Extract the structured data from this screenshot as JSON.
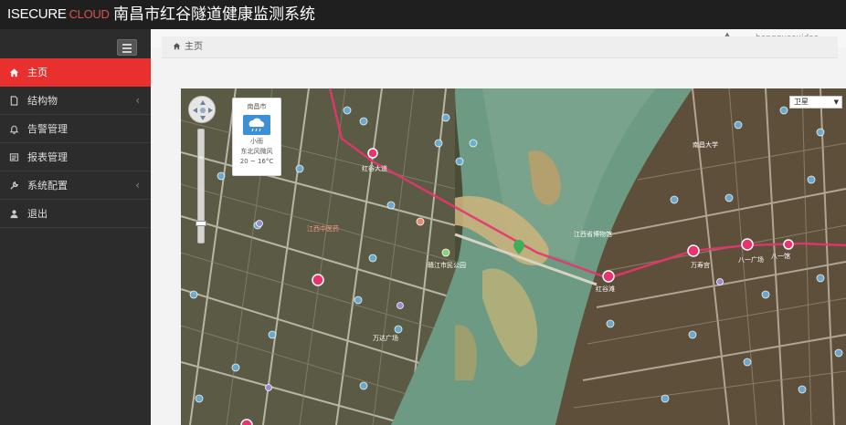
{
  "brand": {
    "logo_main": "ISECURE",
    "logo_sub": "CLOUD",
    "accent": "#e8312f"
  },
  "app_title": "南昌市红谷隧道健康监测系统",
  "sidebar": {
    "items": [
      {
        "label": "主页",
        "icon": "home-icon",
        "active": true,
        "has_submenu": false
      },
      {
        "label": "结构物",
        "icon": "document-icon",
        "active": false,
        "has_submenu": true
      },
      {
        "label": "告警管理",
        "icon": "bell-icon",
        "active": false,
        "has_submenu": false
      },
      {
        "label": "报表管理",
        "icon": "report-icon",
        "active": false,
        "has_submenu": false
      },
      {
        "label": "系统配置",
        "icon": "wrench-icon",
        "active": false,
        "has_submenu": true
      },
      {
        "label": "退出",
        "icon": "user-icon",
        "active": false,
        "has_submenu": false
      }
    ],
    "chevron": "‹"
  },
  "header": {
    "username": "hongguasuidao",
    "warning_icon": "warning-icon"
  },
  "breadcrumb": {
    "label": "主页"
  },
  "map": {
    "layer_select": "卫星",
    "weather": {
      "city": "南昌市",
      "condition": "小雨",
      "wind": "东北风微风",
      "temp": "20 ~ 16°C"
    },
    "route_color": "#e8336f",
    "labels": [
      "红谷大道",
      "万寿宫",
      "八一广场",
      "赣江市民公园",
      "江西省博物馆",
      "江西中医药",
      "红谷滩",
      "南昌大学",
      "万达广场",
      "八一馆"
    ]
  }
}
